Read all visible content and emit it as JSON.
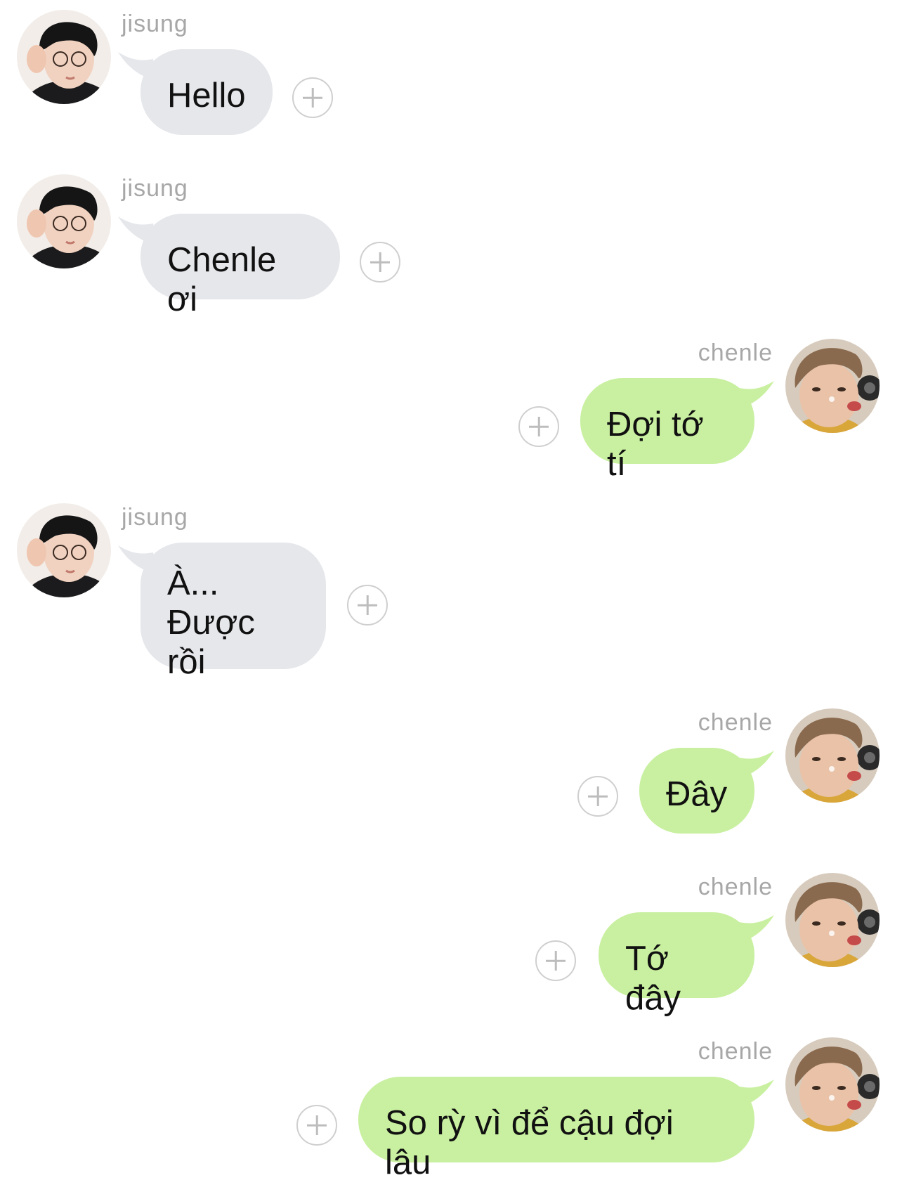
{
  "colors": {
    "incoming_bubble": "#e5e7eb",
    "outgoing_bubble": "#c9f0a0",
    "sender_name": "#a7a7a7",
    "add_reaction_circle": "#cfcfcf"
  },
  "messages": [
    {
      "sender": "jisung",
      "side": "left",
      "text": "Hello",
      "avatar": "jisung-avatar",
      "action_icon": "add-reaction-icon"
    },
    {
      "sender": "jisung",
      "side": "left",
      "text": "Chenle ơi",
      "avatar": "jisung-avatar",
      "action_icon": "add-reaction-icon"
    },
    {
      "sender": "chenle",
      "side": "right",
      "text": "Đợi tớ tí",
      "avatar": "chenle-avatar",
      "action_icon": "add-reaction-icon"
    },
    {
      "sender": "jisung",
      "side": "left",
      "text": "À...\nĐược rồi",
      "avatar": "jisung-avatar",
      "action_icon": "add-reaction-icon"
    },
    {
      "sender": "chenle",
      "side": "right",
      "text": "Đây",
      "avatar": "chenle-avatar",
      "action_icon": "add-reaction-icon"
    },
    {
      "sender": "chenle",
      "side": "right",
      "text": "Tớ đây",
      "avatar": "chenle-avatar",
      "action_icon": "add-reaction-icon"
    },
    {
      "sender": "chenle",
      "side": "right",
      "text": "So rỳ vì để cậu đợi lâu",
      "avatar": "chenle-avatar",
      "action_icon": "add-reaction-icon"
    }
  ]
}
